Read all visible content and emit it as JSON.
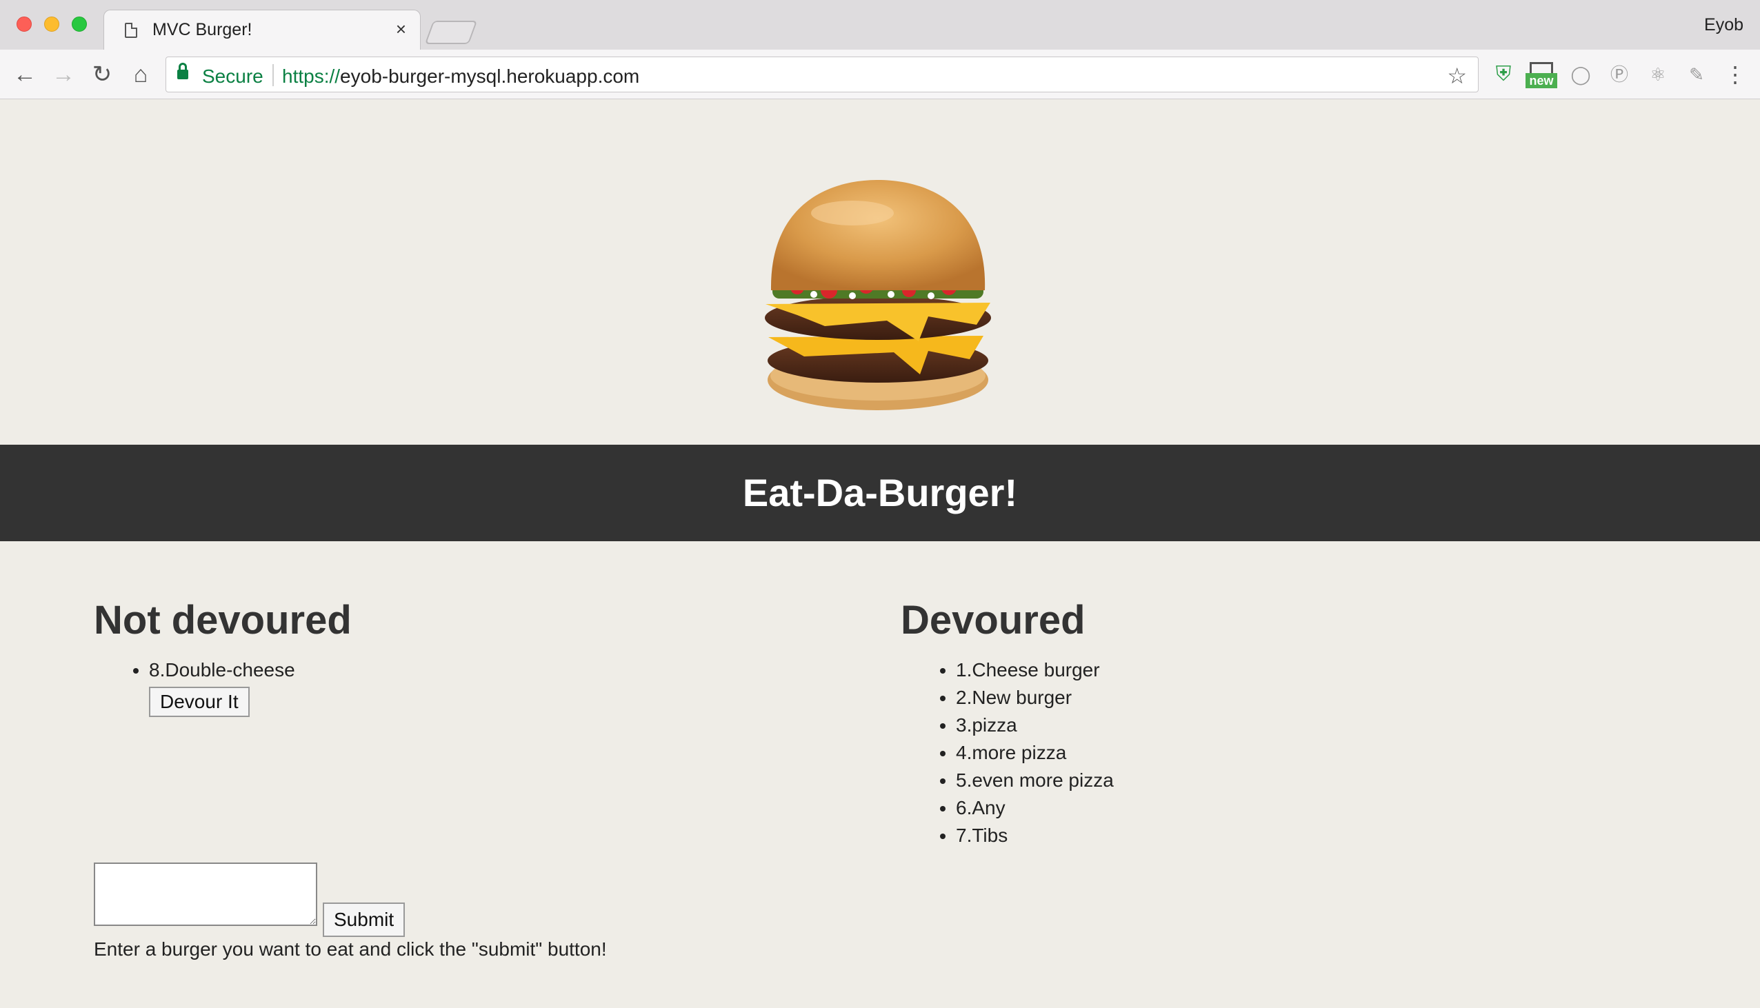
{
  "browser": {
    "tab_title": "MVC Burger!",
    "tab_close": "×",
    "profile_name": "Eyob",
    "secure_label": "Secure",
    "url_scheme": "https://",
    "url_host": "eyob-burger-mysql.herokuapp.com",
    "extension_badge": "new",
    "icons": [
      "back-icon",
      "forward-icon",
      "reload-icon",
      "home-icon",
      "lock-icon",
      "star-icon",
      "shield-extension-icon",
      "new-extension-icon",
      "menu-dots-icon"
    ]
  },
  "page": {
    "banner_title": "Eat-Da-Burger!",
    "not_devoured": {
      "heading": "Not devoured",
      "items": [
        {
          "label": "8.Double-cheese",
          "button": "Devour It"
        }
      ]
    },
    "devoured": {
      "heading": "Devoured",
      "items": [
        "1.Cheese burger",
        "2.New burger",
        "3.pizza",
        "4.more pizza",
        "5.even more pizza",
        "6.Any",
        "7.Tibs"
      ]
    },
    "form": {
      "textarea_value": "",
      "submit_label": "Submit",
      "hint": "Enter a burger you want to eat and click the \"submit\" button!"
    },
    "colors": {
      "background": "#efede7",
      "banner": "#333333",
      "secure_green": "#0b8043"
    }
  }
}
